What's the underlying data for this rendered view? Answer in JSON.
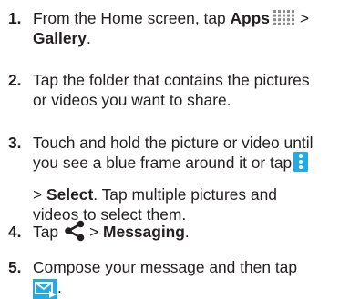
{
  "steps": [
    {
      "number": "1.",
      "line1_text": "From the Home screen, tap ",
      "line1_bold": "Apps",
      "line1_sep": " >",
      "line2_bold": "Gallery",
      "line2_end": ".",
      "icon": "apps-grid-icon"
    },
    {
      "number": "2.",
      "line1": "Tap the folder that contains the pictures",
      "line2": "or videos you want to share."
    },
    {
      "number": "3.",
      "line1": "Touch and hold the picture or video until",
      "line2_text": "you see a blue frame around it or tap",
      "line3_sep": "> ",
      "line3_bold": "Select",
      "line3_end": ". Tap multiple pictures and",
      "line4": "videos to select them.",
      "icon": "more-options-icon"
    },
    {
      "number": "4.",
      "text": "Tap",
      "sep": "> ",
      "bold": "Messaging",
      "end": ".",
      "icon": "share-icon"
    },
    {
      "number": "5.",
      "line1": "Compose your message and then tap",
      "end": ".",
      "icon": "send-message-icon"
    }
  ],
  "colors": {
    "text": "#231f20",
    "apps_icon": "#8a8a8a",
    "accent_blue": "#24a9e1"
  }
}
